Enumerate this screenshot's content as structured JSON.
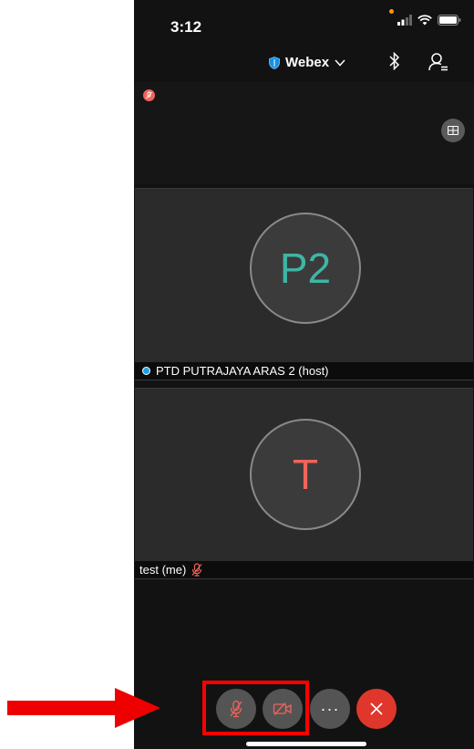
{
  "status_bar": {
    "time": "3:12",
    "recording_dot_color": "#ff9500"
  },
  "app_bar": {
    "title": "Webex",
    "title_icon": "shield-icon",
    "dropdown_icon": "chevron-down-icon",
    "bluetooth_icon": "bluetooth-icon",
    "participants_icon": "participants-icon"
  },
  "self_view": {
    "muted_indicator_icon": "mic-muted-icon",
    "layout_button_icon": "grid-layout-icon"
  },
  "participants": [
    {
      "initials": "P2",
      "initials_color": "#3fb5a5",
      "name_label": "PTD PUTRAJAYA ARAS 2 (host)",
      "host_badge_color": "#1fa0e0"
    },
    {
      "initials": "T",
      "initials_color": "#f0645a",
      "name_label": "test (me)",
      "muted_icon": "mic-muted-icon",
      "muted_color": "#f0645a"
    }
  ],
  "controls": {
    "mute_icon": "mic-muted-icon",
    "video_icon": "video-off-icon",
    "more_label": "···",
    "leave_icon": "close-icon",
    "accent_muted": "#f0645a",
    "leave_color": "#e0372c"
  },
  "annotation": {
    "highlight_color": "#ff0000",
    "arrow_color": "#ee0000"
  }
}
